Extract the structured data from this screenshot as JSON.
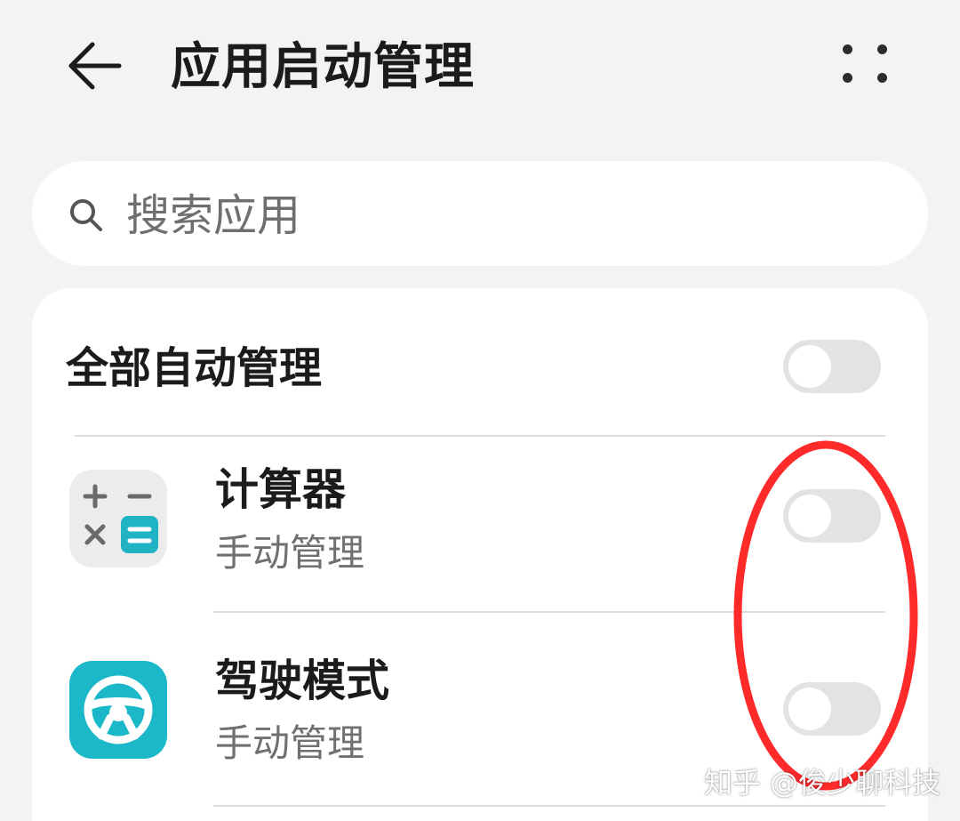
{
  "header": {
    "title": "应用启动管理",
    "back_icon": "arrow-left-icon",
    "more_icon": "more-dots-icon"
  },
  "search": {
    "placeholder": "搜索应用",
    "value": "",
    "icon": "search-icon"
  },
  "master": {
    "label": "全部自动管理",
    "enabled": false
  },
  "apps": [
    {
      "name": "计算器",
      "status": "手动管理",
      "icon": "calculator-icon",
      "enabled": false
    },
    {
      "name": "驾驶模式",
      "status": "手动管理",
      "icon": "steering-wheel-icon",
      "enabled": false
    }
  ],
  "watermark": "知乎 @俊少聊科技",
  "colors": {
    "background": "#f1f3f5",
    "card": "#ffffff",
    "toggle_off": "#e3e3e3",
    "calculator_accent": "#1fb3c4",
    "driving_icon_bg": "#1ab8c9",
    "annotation": "#ff2a2a"
  }
}
